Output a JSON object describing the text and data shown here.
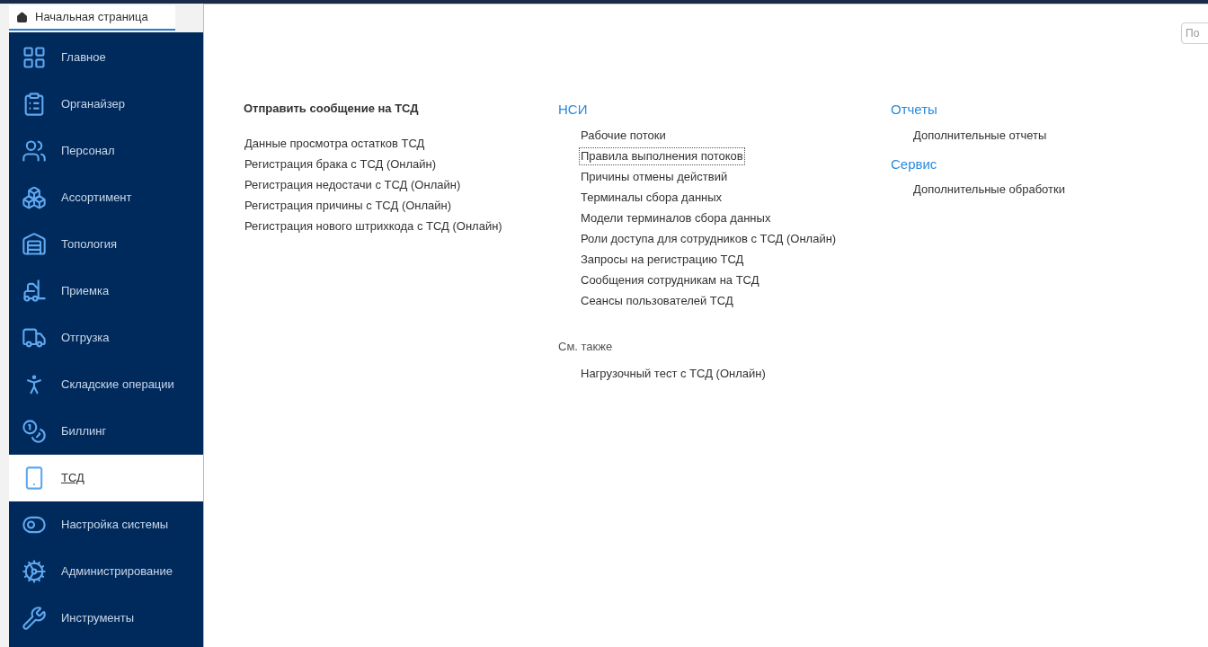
{
  "home_tab": {
    "label": "Начальная страница",
    "selected": true
  },
  "sidebar": {
    "items": [
      {
        "label": "Главное",
        "selected": false
      },
      {
        "label": "Органайзер",
        "selected": false
      },
      {
        "label": "Персонал",
        "selected": false
      },
      {
        "label": "Ассортимент",
        "selected": false
      },
      {
        "label": "Топология",
        "selected": false
      },
      {
        "label": "Приемка",
        "selected": false
      },
      {
        "label": "Отгрузка",
        "selected": false
      },
      {
        "label": "Складские операции",
        "selected": false
      },
      {
        "label": "Биллинг",
        "selected": false
      },
      {
        "label": "ТСД",
        "selected": true
      },
      {
        "label": "Настройка системы",
        "selected": false
      },
      {
        "label": "Администрирование",
        "selected": false
      },
      {
        "label": "Инструменты",
        "selected": false
      }
    ]
  },
  "search": {
    "placeholder": "По"
  },
  "columns": [
    {
      "sections": [
        {
          "kind": "command",
          "title": "Отправить сообщение на ТСД",
          "items": [
            {
              "label": "Данные просмотра остатков ТСД",
              "focused": false
            },
            {
              "label": "Регистрация брака с ТСД (Онлайн)",
              "focused": false
            },
            {
              "label": "Регистрация недостачи с ТСД (Онлайн)",
              "focused": false
            },
            {
              "label": "Регистрация причины с ТСД (Онлайн)",
              "focused": false
            },
            {
              "label": "Регистрация нового штрихкода с ТСД (Онлайн)",
              "focused": false
            }
          ]
        }
      ]
    },
    {
      "sections": [
        {
          "kind": "group",
          "title": "НСИ",
          "items": [
            {
              "label": "Рабочие потоки",
              "focused": false
            },
            {
              "label": "Правила выполнения потоков",
              "focused": true
            },
            {
              "label": "Причины отмены действий",
              "focused": false
            },
            {
              "label": "Терминалы сбора данных",
              "focused": false
            },
            {
              "label": "Модели терминалов сбора данных",
              "focused": false
            },
            {
              "label": "Роли доступа для сотрудников с ТСД (Онлайн)",
              "focused": false
            },
            {
              "label": "Запросы на регистрацию ТСД",
              "focused": false
            },
            {
              "label": "Сообщения сотрудникам на ТСД",
              "focused": false
            },
            {
              "label": "Сеансы пользователей ТСД",
              "focused": false
            }
          ]
        },
        {
          "kind": "see_also",
          "title": "См. также",
          "items": [
            {
              "label": "Нагрузочный тест с ТСД (Онлайн)",
              "focused": false
            }
          ]
        }
      ]
    },
    {
      "sections": [
        {
          "kind": "group",
          "title": "Отчеты",
          "items": [
            {
              "label": "Дополнительные отчеты",
              "focused": false
            }
          ]
        },
        {
          "kind": "group",
          "title": "Сервис",
          "items": [
            {
              "label": "Дополнительные обработки",
              "focused": false
            }
          ]
        }
      ]
    }
  ]
}
